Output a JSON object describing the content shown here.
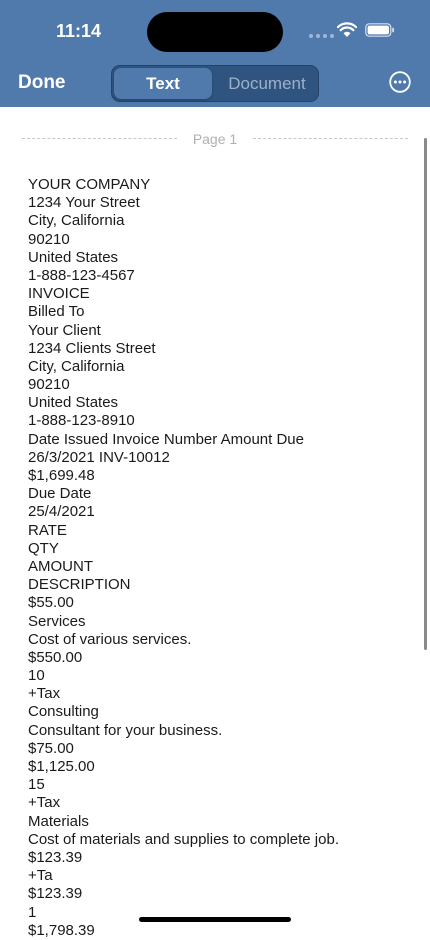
{
  "status": {
    "time": "11:14"
  },
  "toolbar": {
    "done_label": "Done",
    "segments": [
      "Text",
      "Document"
    ],
    "selected_segment": "Text",
    "more_icon": "ellipsis-circle-icon"
  },
  "document": {
    "page_label": "Page 1",
    "lines": [
      "YOUR COMPANY",
      "1234 Your Street",
      "City, California",
      "90210",
      "United States",
      "1-888-123-4567",
      "INVOICE",
      "Billed To",
      "Your Client",
      "1234 Clients Street",
      "City, California",
      "90210",
      "United States",
      "1-888-123-8910",
      "Date Issued Invoice Number Amount Due",
      "26/3/2021 INV-10012",
      "$1,699.48",
      "Due Date",
      "25/4/2021",
      "RATE",
      "QTY",
      "AMOUNT",
      "DESCRIPTION",
      "$55.00",
      "Services",
      "Cost of various services.",
      "$550.00",
      "10",
      "+Tax",
      "Consulting",
      "Consultant for your business.",
      "$75.00",
      "$1,125.00",
      "15",
      "+Tax",
      "Materials",
      "Cost of materials and supplies to complete job.",
      "$123.39",
      "+Ta",
      "$123.39",
      "1",
      "$1,798.39"
    ]
  },
  "colors": {
    "header": "#5079ac",
    "segment_bg": "#2f5480"
  }
}
